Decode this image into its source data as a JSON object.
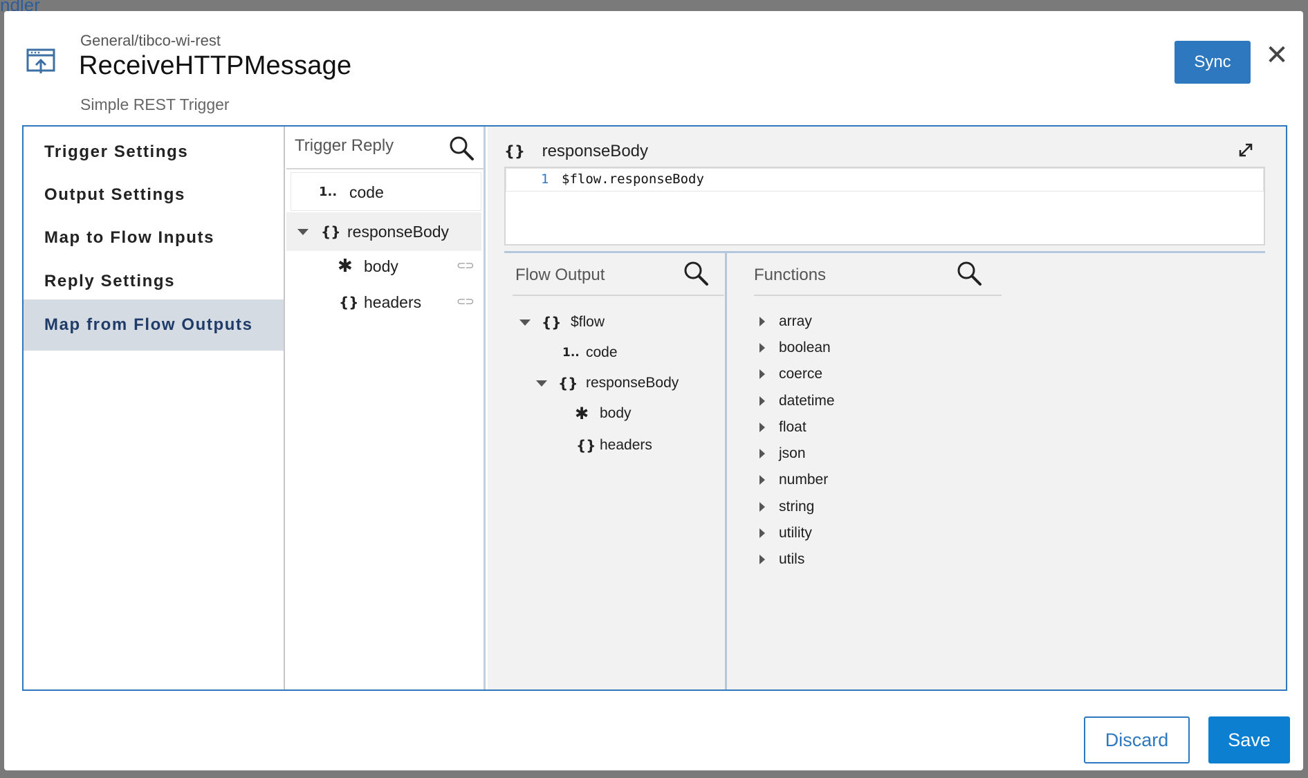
{
  "background": {
    "partial_text": "ndler"
  },
  "header": {
    "path": "General/tibco-wi-rest",
    "title": "ReceiveHTTPMessage",
    "subtitle": "Simple REST Trigger",
    "sync_label": "Sync",
    "close_glyph": "✕",
    "icon": "trigger-upload-icon"
  },
  "nav": {
    "items": [
      {
        "label": "Trigger Settings"
      },
      {
        "label": "Output Settings"
      },
      {
        "label": "Map to Flow Inputs"
      },
      {
        "label": "Reply Settings"
      },
      {
        "label": "Map from Flow Outputs"
      }
    ],
    "active_index": 4
  },
  "trigger_reply": {
    "title": "Trigger Reply",
    "items": [
      {
        "type_glyph": "1..",
        "label": "code"
      },
      {
        "type_glyph": "{}",
        "label": "responseBody"
      },
      {
        "type_glyph": "✱",
        "label": "body",
        "link_glyph": "⊂⊃"
      },
      {
        "type_glyph": "{}",
        "label": "headers",
        "link_glyph": "⊂⊃"
      }
    ]
  },
  "editor": {
    "glyph": "{}",
    "title": "responseBody",
    "line_number": "1",
    "code": "$flow.responseBody"
  },
  "flow_output": {
    "title": "Flow Output",
    "items": [
      {
        "type_glyph": "{}",
        "label": "$flow"
      },
      {
        "type_glyph": "1..",
        "label": "code"
      },
      {
        "type_glyph": "{}",
        "label": "responseBody"
      },
      {
        "type_glyph": "✱",
        "label": "body"
      },
      {
        "type_glyph": "{}",
        "label": "headers"
      }
    ]
  },
  "functions": {
    "title": "Functions",
    "items": [
      "array",
      "boolean",
      "coerce",
      "datetime",
      "float",
      "json",
      "number",
      "string",
      "utility",
      "utils"
    ]
  },
  "footer": {
    "discard_label": "Discard",
    "save_label": "Save"
  },
  "colors": {
    "accent": "#2e78bf",
    "save": "#0c7fd0",
    "active_nav_bg": "#d4dbe3",
    "workspace_bg": "#f2f2f2"
  }
}
